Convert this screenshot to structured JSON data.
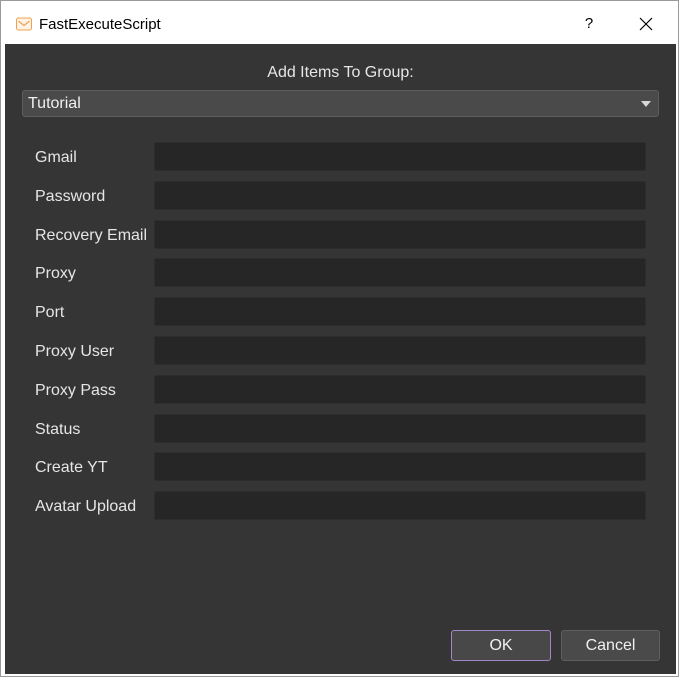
{
  "window": {
    "title": "FastExecuteScript",
    "help_label": "?"
  },
  "dialog": {
    "group_label": "Add Items To Group:",
    "group_select": {
      "selected": "Tutorial"
    },
    "fields": [
      {
        "label": "Gmail",
        "value": ""
      },
      {
        "label": "Password",
        "value": ""
      },
      {
        "label": "Recovery Email",
        "value": ""
      },
      {
        "label": "Proxy",
        "value": ""
      },
      {
        "label": "Port",
        "value": ""
      },
      {
        "label": "Proxy User",
        "value": ""
      },
      {
        "label": "Proxy Pass",
        "value": ""
      },
      {
        "label": "Status",
        "value": ""
      },
      {
        "label": "Create YT",
        "value": ""
      },
      {
        "label": "Avatar Upload",
        "value": ""
      }
    ],
    "buttons": {
      "ok_label": "OK",
      "cancel_label": "Cancel"
    }
  },
  "colors": {
    "background": "#353535",
    "input_background": "#262626",
    "focus_accent": "#a286c8",
    "app_icon": "#f0a050"
  },
  "icons": {
    "app": "envelope-icon",
    "close": "close-icon",
    "dropdown": "chevron-down-icon"
  }
}
